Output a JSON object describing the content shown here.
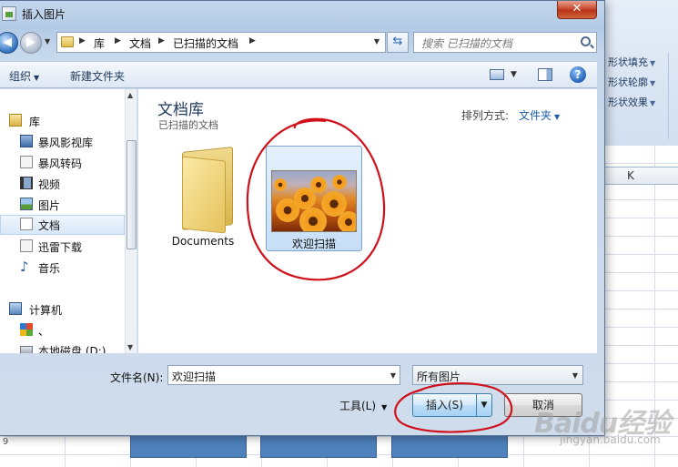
{
  "dialog": {
    "title": "插入图片",
    "close_label": "✕"
  },
  "address": {
    "segments": [
      "库",
      "文档",
      "已扫描的文档"
    ],
    "search_placeholder": "搜索 已扫描的文档"
  },
  "toolbar": {
    "organize": "组织",
    "new_folder": "新建文件夹",
    "help": "?"
  },
  "nav": {
    "library_header": "库",
    "items": [
      "暴风影视库",
      "暴风转码",
      "视频",
      "图片",
      "文档",
      "迅雷下载",
      "音乐"
    ],
    "computer": "计算机",
    "drive_c": "、",
    "drive_d": "本地磁盘 (D:)"
  },
  "main": {
    "library_title": "文档库",
    "library_subtitle": "已扫描的文档",
    "arrange_label": "排列方式:",
    "arrange_value": "文件夹",
    "files": [
      {
        "name": "Documents",
        "type": "folder"
      },
      {
        "name": "欢迎扫描",
        "type": "image"
      }
    ]
  },
  "bottom": {
    "filename_label": "文件名(N):",
    "filename_value": "欢迎扫描",
    "filetype_value": "所有图片",
    "tools_label": "工具(L)",
    "insert_label": "插入(S)",
    "cancel_label": "取消"
  },
  "excel": {
    "ribbon_items": [
      "形状填充",
      "形状轮廓",
      "形状效果"
    ],
    "column_k": "K",
    "row_label": "9"
  },
  "watermark": {
    "brand": "Baidu经验",
    "url": "jingyan.baidu.com"
  },
  "colors": {
    "accent": "#1e5ea8",
    "annotation": "#d0101a",
    "shape_fill": "#4f81bd"
  }
}
